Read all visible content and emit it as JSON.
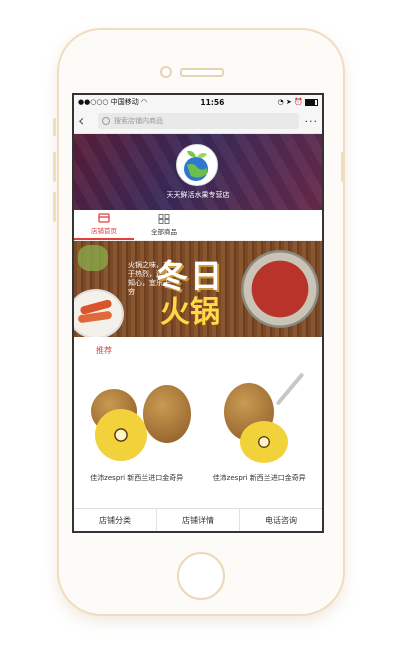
{
  "status": {
    "carrier": "中国移动",
    "time": "11:56"
  },
  "nav": {
    "search_placeholder": "搜索店铺内商品",
    "more": "···"
  },
  "shop": {
    "name": "天天鲜活水果专营店"
  },
  "tabs": [
    {
      "label": "店铺首页"
    },
    {
      "label": "全部商品"
    }
  ],
  "promo": {
    "title_top": "冬日",
    "title_bottom": "火锅",
    "slogan": "火锅之味，在于热烈，适于知心，宜乐无穷"
  },
  "section": {
    "title": "推荐"
  },
  "products": [
    {
      "name": "佳沛zespri 新西兰进口金奇异"
    },
    {
      "name": "佳沛zespri 新西兰进口金奇异"
    }
  ],
  "bottom_bar": [
    {
      "label": "店铺分类"
    },
    {
      "label": "店铺详情"
    },
    {
      "label": "电话咨询"
    }
  ],
  "colors": {
    "accent": "#e04040",
    "frame": "#f1dcc0"
  }
}
